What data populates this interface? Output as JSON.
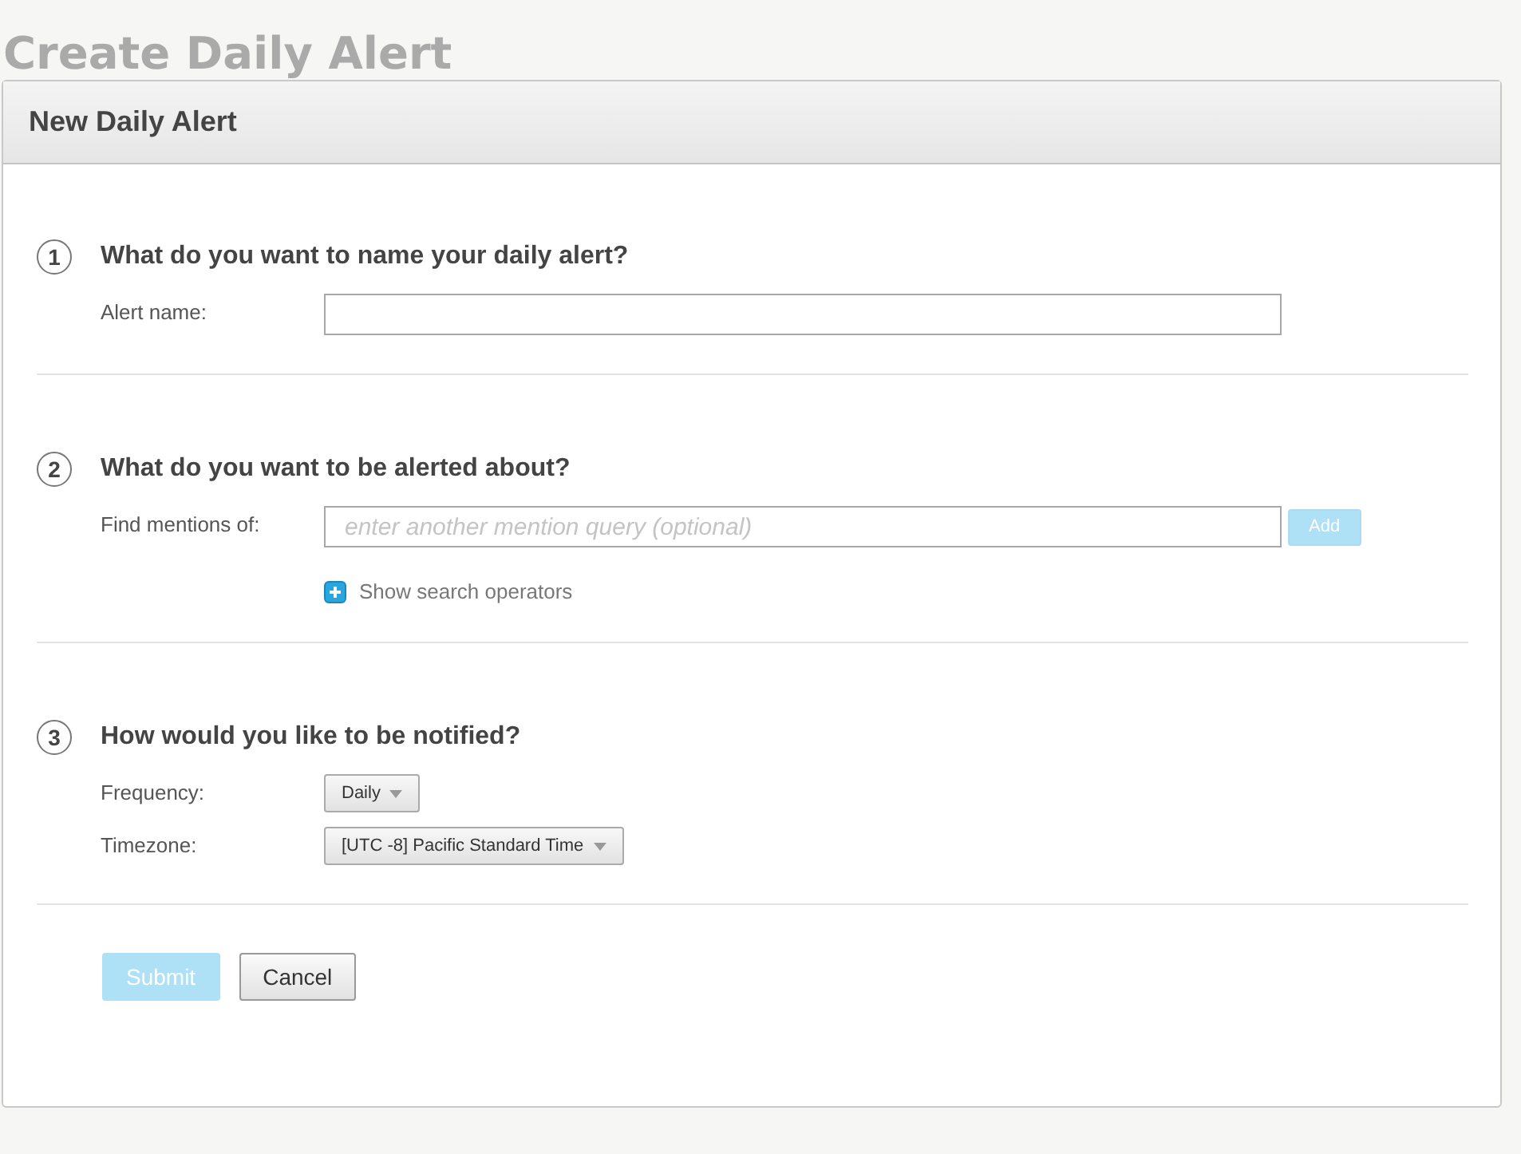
{
  "page_title": "Create Daily Alert",
  "panel": {
    "title": "New Daily Alert"
  },
  "sections": [
    {
      "number": "1",
      "heading": "What do you want to name your daily alert?",
      "fields": [
        {
          "kind": "text",
          "label": "Alert name:"
        }
      ]
    },
    {
      "number": "2",
      "heading": "What do you want to be alerted about?",
      "fields": [
        {
          "kind": "query",
          "label": "Find mentions of:",
          "placeholder": "enter another mention query (optional)",
          "button": {
            "label": "Add",
            "disabled": true
          },
          "link": "Show search operators"
        }
      ]
    },
    {
      "number": "3",
      "heading": "How would you like to be notified?",
      "fields": [
        {
          "kind": "select",
          "label": "Frequency:",
          "value": "Daily"
        },
        {
          "kind": "select",
          "label": "Timezone:",
          "value": "[UTC -8] Pacific Standard Time"
        }
      ]
    }
  ],
  "actions": [
    {
      "label": "Submit",
      "kind": "primary",
      "disabled": true
    },
    {
      "label": "Cancel",
      "kind": "secondary",
      "disabled": false
    }
  ]
}
